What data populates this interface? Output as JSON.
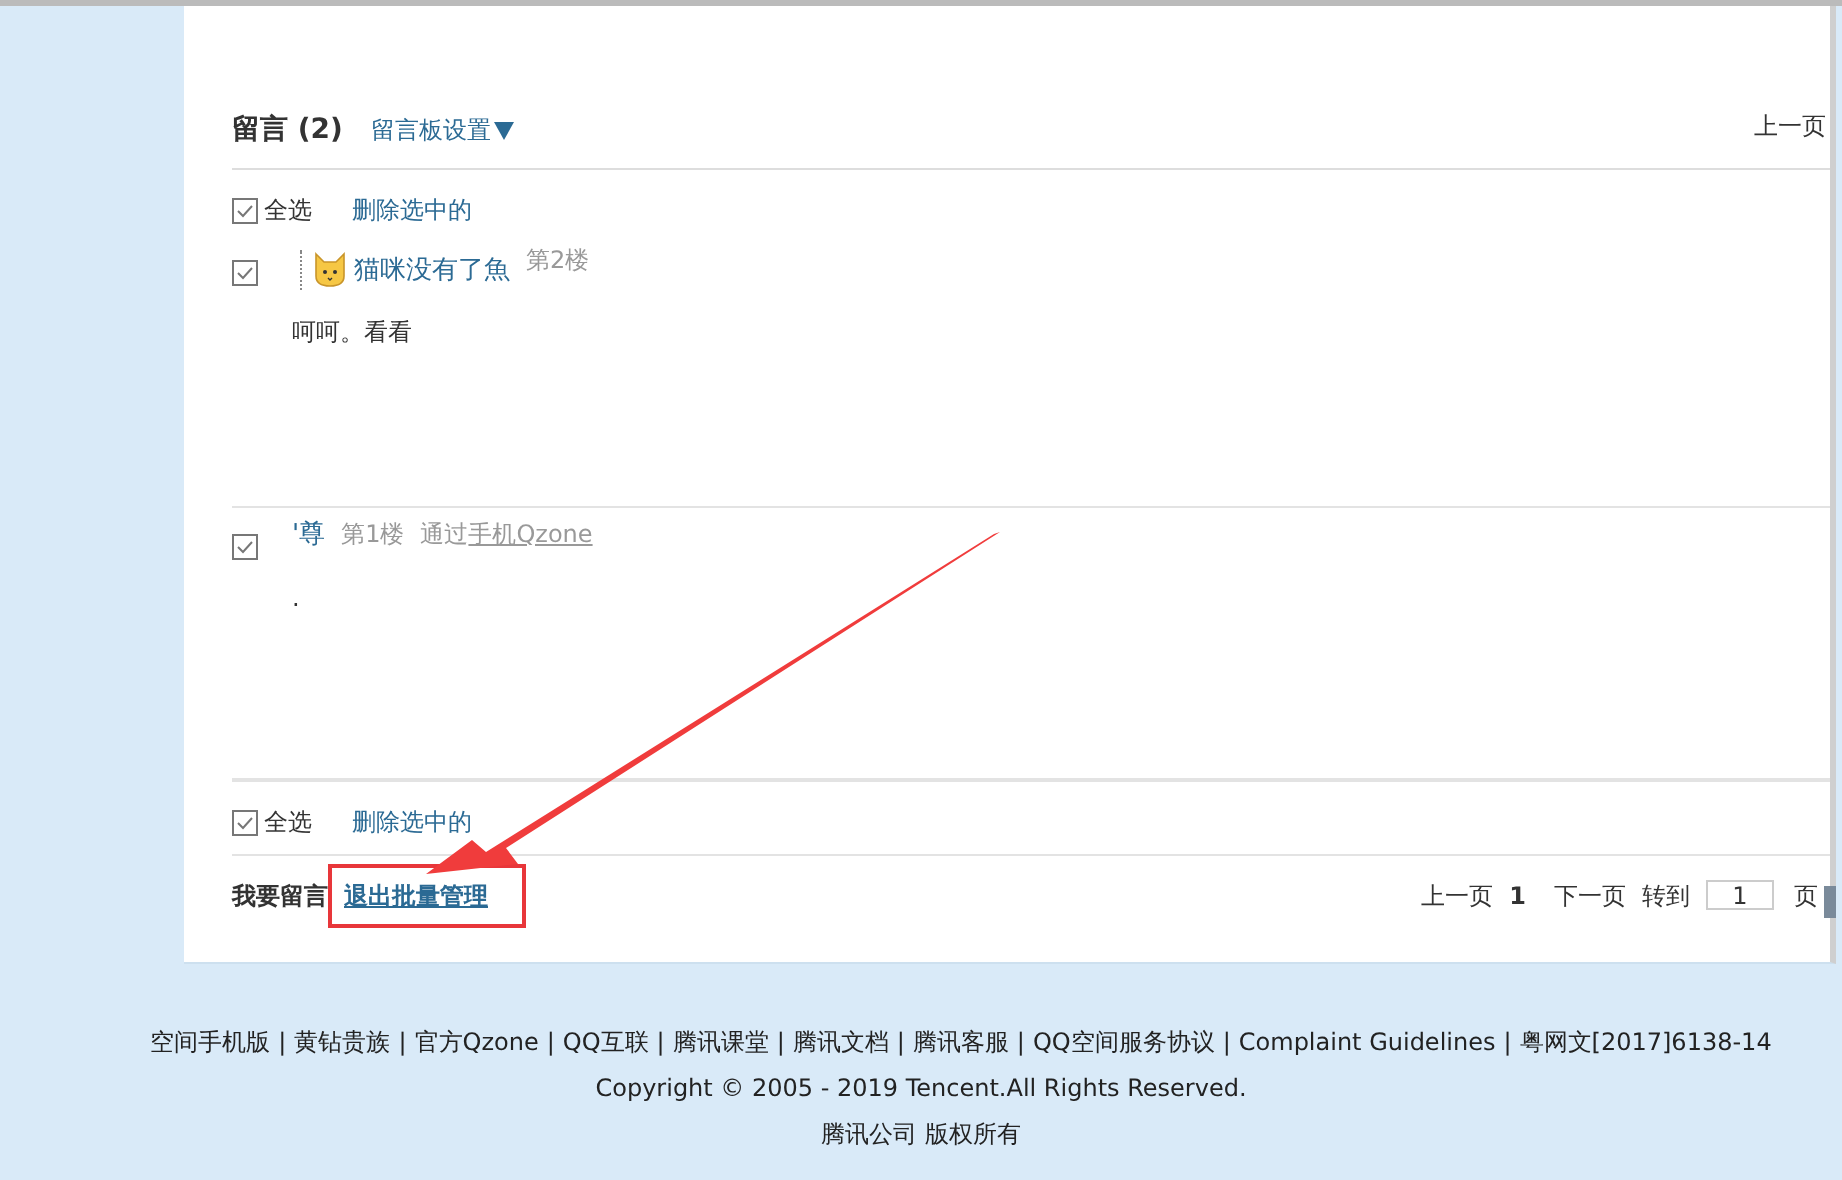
{
  "header": {
    "title": "留言 (2)",
    "settings_link": "留言板设置",
    "top_pager_prev": "上一页"
  },
  "select_bar_top": {
    "checked": true,
    "select_all": "全选",
    "delete_selected": "删除选中的"
  },
  "messages": [
    {
      "checked": true,
      "kind": "avatar",
      "author": "猫咪没有了魚",
      "floor": "第2楼",
      "text": "呵呵。看看"
    },
    {
      "checked": true,
      "kind": "mobile",
      "author": "'尊",
      "floor": "第1楼",
      "via_prefix": "通过",
      "via_link": "手机Qzone",
      "text": "."
    }
  ],
  "select_bar_bottom": {
    "checked": true,
    "select_all": "全选",
    "delete_selected": "删除选中的"
  },
  "actions": {
    "leave_message": "我要留言",
    "exit_batch": "退出批量管理"
  },
  "pager": {
    "prev": "上一页",
    "current": "1",
    "next": "下一页",
    "goto": "转到",
    "page_input": "1",
    "page_unit": "页"
  },
  "footer": {
    "separator": "|",
    "links": [
      "空间手机版",
      "黄钻贵族",
      "官方Qzone",
      "QQ互联",
      "腾讯课堂",
      "腾讯文档",
      "腾讯客服",
      "QQ空间服务协议",
      "Complaint Guidelines",
      "粤网文[2017]6138-14"
    ],
    "copyright": "Copyright © 2005 - 2019 Tencent.All Rights Reserved.",
    "company": "腾讯公司 版权所有"
  }
}
